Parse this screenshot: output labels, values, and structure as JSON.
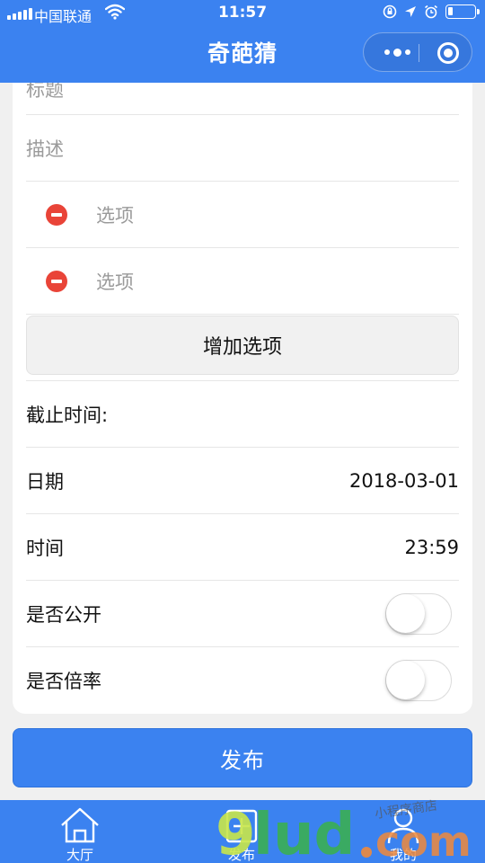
{
  "status": {
    "carrier": "中国联通",
    "time": "11:57"
  },
  "nav": {
    "title": "奇葩猜"
  },
  "form": {
    "title_placeholder": "标题",
    "description_placeholder": "描述",
    "options": [
      {
        "placeholder": "选项"
      },
      {
        "placeholder": "选项"
      }
    ],
    "add_option_label": "增加选项",
    "deadline_label": "截止时间:",
    "date_label": "日期",
    "date_value": "2018-03-01",
    "time_label": "时间",
    "time_value": "23:59",
    "public_label": "是否公开",
    "public_on": false,
    "multiplier_label": "是否倍率",
    "multiplier_on": false
  },
  "publish_label": "发布",
  "tabs": [
    {
      "label": "大厅",
      "icon": "home-icon"
    },
    {
      "label": "发布",
      "icon": "publish-icon"
    },
    {
      "label": "我的",
      "icon": "person-icon"
    }
  ],
  "watermark": {
    "text": "9lud.com",
    "tagline": "小程序商店"
  },
  "colors": {
    "primary": "#3b82f0",
    "danger": "#e94438"
  }
}
